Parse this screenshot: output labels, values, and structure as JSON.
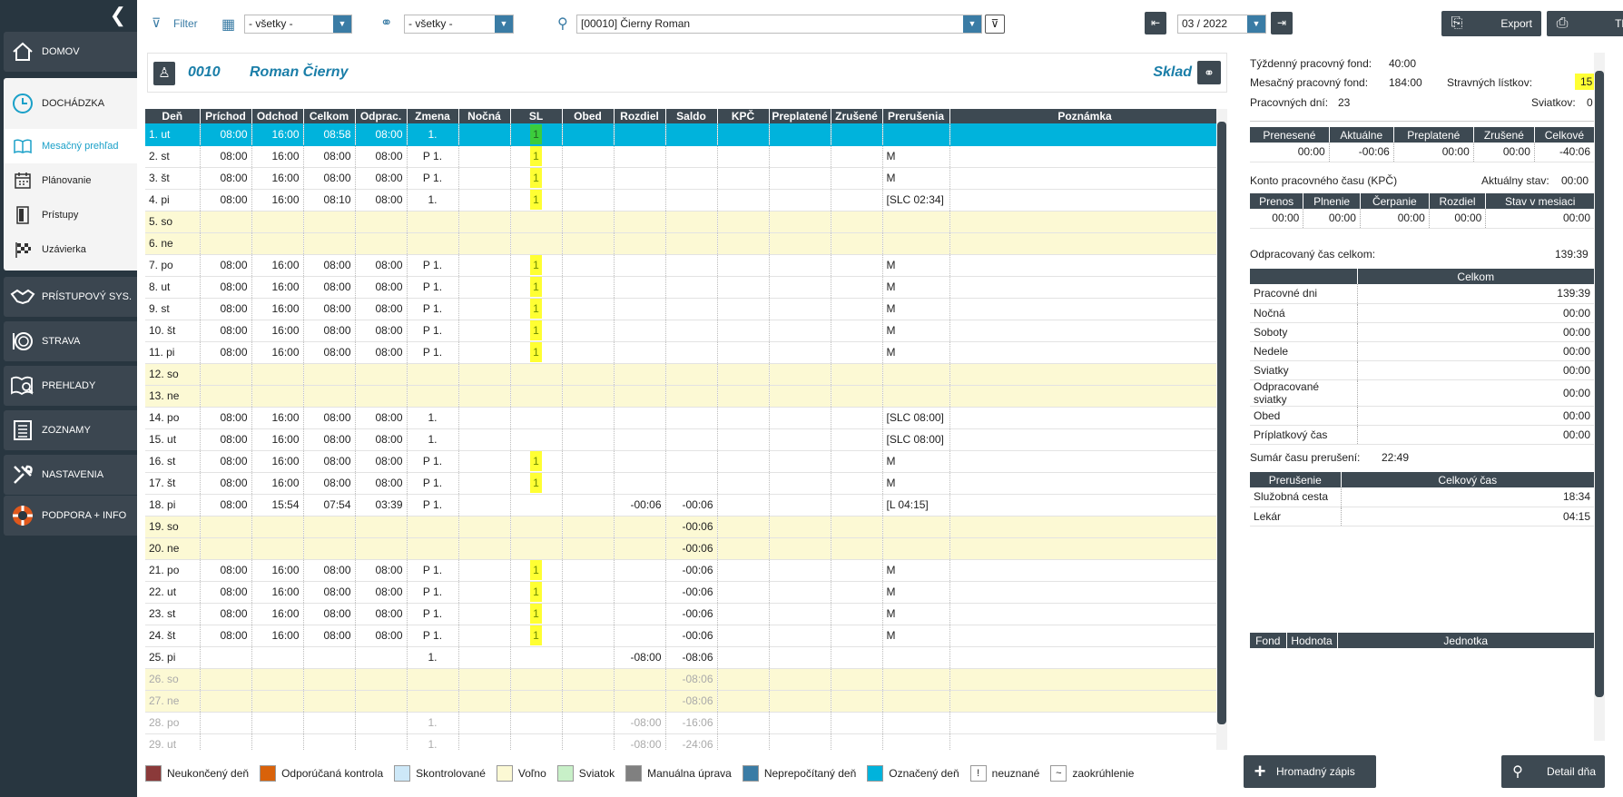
{
  "sidebar": {
    "domov": "DOMOV",
    "dochadzka": "DOCHÁDZKA",
    "sub": [
      "Mesačný prehľad",
      "Plánovanie",
      "Prístupy",
      "Uzávierka"
    ],
    "items": [
      "PRÍSTUPOVÝ SYS.",
      "STRAVA",
      "PREHĽADY",
      "ZOZNAMY",
      "NASTAVENIA",
      "PODPORA + INFO"
    ]
  },
  "toolbar": {
    "filter": "Filter",
    "sel1": "- všetky -",
    "sel2": "- všetky -",
    "person": "[00010] Čierny Roman",
    "period": "03 / 2022",
    "export": "Export",
    "print": "Tlačiť"
  },
  "header": {
    "id": "0010",
    "name": "Roman Čierny",
    "dept": "Sklad"
  },
  "grid": {
    "columns": [
      "Deň",
      "Príchod",
      "Odchod",
      "Celkom",
      "Odprac.",
      "Zmena",
      "Nočná",
      "SL",
      "Obed",
      "Rozdiel",
      "Saldo",
      "KPČ",
      "Preplatené",
      "Zrušené",
      "Prerušenia",
      "Poznámka"
    ],
    "rows": [
      [
        "1. ut",
        "08:00",
        "16:00",
        "08:58",
        "08:00",
        "1.",
        "",
        "1",
        "",
        "",
        "",
        "",
        "",
        "",
        "",
        ""
      ],
      [
        "2. st",
        "08:00",
        "16:00",
        "08:00",
        "08:00",
        "P 1.",
        "",
        "1",
        "",
        "",
        "",
        "",
        "",
        "",
        "M",
        ""
      ],
      [
        "3. št",
        "08:00",
        "16:00",
        "08:00",
        "08:00",
        "P 1.",
        "",
        "1",
        "",
        "",
        "",
        "",
        "",
        "",
        "M",
        ""
      ],
      [
        "4. pi",
        "08:00",
        "16:00",
        "08:10",
        "08:00",
        "1.",
        "",
        "1",
        "",
        "",
        "",
        "",
        "",
        "",
        "[SLC 02:34]",
        ""
      ],
      [
        "5. so",
        "",
        "",
        "",
        "",
        "",
        "",
        "",
        "",
        "",
        "",
        "",
        "",
        "",
        "",
        ""
      ],
      [
        "6. ne",
        "",
        "",
        "",
        "",
        "",
        "",
        "",
        "",
        "",
        "",
        "",
        "",
        "",
        "",
        ""
      ],
      [
        "7. po",
        "08:00",
        "16:00",
        "08:00",
        "08:00",
        "P 1.",
        "",
        "1",
        "",
        "",
        "",
        "",
        "",
        "",
        "M",
        ""
      ],
      [
        "8. ut",
        "08:00",
        "16:00",
        "08:00",
        "08:00",
        "P 1.",
        "",
        "1",
        "",
        "",
        "",
        "",
        "",
        "",
        "M",
        ""
      ],
      [
        "9. st",
        "08:00",
        "16:00",
        "08:00",
        "08:00",
        "P 1.",
        "",
        "1",
        "",
        "",
        "",
        "",
        "",
        "",
        "M",
        ""
      ],
      [
        "10. št",
        "08:00",
        "16:00",
        "08:00",
        "08:00",
        "P 1.",
        "",
        "1",
        "",
        "",
        "",
        "",
        "",
        "",
        "M",
        ""
      ],
      [
        "11. pi",
        "08:00",
        "16:00",
        "08:00",
        "08:00",
        "P 1.",
        "",
        "1",
        "",
        "",
        "",
        "",
        "",
        "",
        "M",
        ""
      ],
      [
        "12. so",
        "",
        "",
        "",
        "",
        "",
        "",
        "",
        "",
        "",
        "",
        "",
        "",
        "",
        "",
        ""
      ],
      [
        "13. ne",
        "",
        "",
        "",
        "",
        "",
        "",
        "",
        "",
        "",
        "",
        "",
        "",
        "",
        "",
        ""
      ],
      [
        "14. po",
        "08:00",
        "16:00",
        "08:00",
        "08:00",
        "1.",
        "",
        "",
        "",
        "",
        "",
        "",
        "",
        "",
        "[SLC 08:00]",
        ""
      ],
      [
        "15. ut",
        "08:00",
        "16:00",
        "08:00",
        "08:00",
        "1.",
        "",
        "",
        "",
        "",
        "",
        "",
        "",
        "",
        "[SLC 08:00]",
        ""
      ],
      [
        "16. st",
        "08:00",
        "16:00",
        "08:00",
        "08:00",
        "P 1.",
        "",
        "1",
        "",
        "",
        "",
        "",
        "",
        "",
        "M",
        ""
      ],
      [
        "17. št",
        "08:00",
        "16:00",
        "08:00",
        "08:00",
        "P 1.",
        "",
        "1",
        "",
        "",
        "",
        "",
        "",
        "",
        "M",
        ""
      ],
      [
        "18. pi",
        "08:00",
        "15:54",
        "07:54",
        "03:39",
        "P 1.",
        "",
        "",
        "",
        "-00:06",
        "-00:06",
        "",
        "",
        "",
        "[L 04:15]",
        ""
      ],
      [
        "19. so",
        "",
        "",
        "",
        "",
        "",
        "",
        "",
        "",
        "",
        "-00:06",
        "",
        "",
        "",
        "",
        ""
      ],
      [
        "20. ne",
        "",
        "",
        "",
        "",
        "",
        "",
        "",
        "",
        "",
        "-00:06",
        "",
        "",
        "",
        "",
        ""
      ],
      [
        "21. po",
        "08:00",
        "16:00",
        "08:00",
        "08:00",
        "P 1.",
        "",
        "1",
        "",
        "",
        "-00:06",
        "",
        "",
        "",
        "M",
        ""
      ],
      [
        "22. ut",
        "08:00",
        "16:00",
        "08:00",
        "08:00",
        "P 1.",
        "",
        "1",
        "",
        "",
        "-00:06",
        "",
        "",
        "",
        "M",
        ""
      ],
      [
        "23. st",
        "08:00",
        "16:00",
        "08:00",
        "08:00",
        "P 1.",
        "",
        "1",
        "",
        "",
        "-00:06",
        "",
        "",
        "",
        "M",
        ""
      ],
      [
        "24. št",
        "08:00",
        "16:00",
        "08:00",
        "08:00",
        "P 1.",
        "",
        "1",
        "",
        "",
        "-00:06",
        "",
        "",
        "",
        "M",
        ""
      ],
      [
        "25. pi",
        "",
        "",
        "",
        "",
        "1.",
        "",
        "",
        "",
        "-08:00",
        "-08:06",
        "",
        "",
        "",
        "",
        ""
      ],
      [
        "26. so",
        "",
        "",
        "",
        "",
        "",
        "",
        "",
        "",
        "",
        "-08:06",
        "",
        "",
        "",
        "",
        ""
      ],
      [
        "27. ne",
        "",
        "",
        "",
        "",
        "",
        "",
        "",
        "",
        "",
        "-08:06",
        "",
        "",
        "",
        "",
        ""
      ],
      [
        "28. po",
        "",
        "",
        "",
        "",
        "1.",
        "",
        "",
        "",
        "-08:00",
        "-16:06",
        "",
        "",
        "",
        "",
        ""
      ],
      [
        "29. ut",
        "",
        "",
        "",
        "",
        "1.",
        "",
        "",
        "",
        "-08:00",
        "-24:06",
        "",
        "",
        "",
        "",
        ""
      ]
    ],
    "row_types": [
      "selected",
      "work",
      "work",
      "work",
      "weekend",
      "weekend",
      "work",
      "work",
      "work",
      "work",
      "work",
      "weekend",
      "weekend",
      "work",
      "work",
      "work",
      "work",
      "work",
      "weekend",
      "weekend",
      "work",
      "work",
      "work",
      "work",
      "work",
      "weekend",
      "weekend",
      "future",
      "future"
    ],
    "future_weekend_rows": [
      25,
      26
    ]
  },
  "legend": [
    {
      "label": "Neukončený deň",
      "color": "#8b3a3a"
    },
    {
      "label": "Odporúčaná kontrola",
      "color": "#d9620a"
    },
    {
      "label": "Skontrolované",
      "color": "#cde8f8"
    },
    {
      "label": "Voľno",
      "color": "#fcf9d4"
    },
    {
      "label": "Sviatok",
      "color": "#c8f0c8"
    },
    {
      "label": "Manuálna úprava",
      "color": "#808080"
    },
    {
      "label": "Neprepočítaný deň",
      "color": "#3a7ca5"
    },
    {
      "label": "Označený deň",
      "color": "#00b3dc"
    },
    {
      "label": "neuznané",
      "symbol": "!"
    },
    {
      "label": "zaokrúhlenie",
      "symbol": "~"
    }
  ],
  "summary": {
    "tyzdenny_label": "Týždenný pracovný fond:",
    "tyzdenny": "40:00",
    "mesacny_label": "Mesačný pracovný fond:",
    "mesacny": "184:00",
    "stravne_label": "Stravných lístkov:",
    "stravne": "15",
    "prac_dni_label": "Pracovných dní:",
    "prac_dni": "23",
    "sviatkov_label": "Sviatkov:",
    "sviatkov": "0",
    "balance_headers": [
      "Prenesené",
      "Aktuálne",
      "Preplatené",
      "Zrušené",
      "Celkové"
    ],
    "balance_values": [
      "00:00",
      "-00:06",
      "00:00",
      "00:00",
      "-40:06"
    ],
    "kpc_title": "Konto pracovného času (KPČ)",
    "kpc_state_label": "Aktuálny stav:",
    "kpc_state": "00:00",
    "kpc_headers": [
      "Prenos",
      "Plnenie",
      "Čerpanie",
      "Rozdiel",
      "Stav v mesiaci"
    ],
    "kpc_values": [
      "00:00",
      "00:00",
      "00:00",
      "00:00",
      "00:00"
    ],
    "odprac_label": "Odpracovaný čas celkom:",
    "odprac": "139:39",
    "celkom_header": "Celkom",
    "celkom_rows": [
      [
        "Pracovné dni",
        "139:39"
      ],
      [
        "Nočná",
        "00:00"
      ],
      [
        "Soboty",
        "00:00"
      ],
      [
        "Nedele",
        "00:00"
      ],
      [
        "Sviatky",
        "00:00"
      ],
      [
        "Odpracované sviatky",
        "00:00"
      ],
      [
        "Obed",
        "00:00"
      ],
      [
        "Príplatkový čas",
        "00:00"
      ]
    ],
    "prerus_label": "Sumár času prerušení:",
    "prerus": "22:49",
    "prerus_headers": [
      "Prerušenie",
      "Celkový čas"
    ],
    "prerus_rows": [
      [
        "Služobná cesta",
        "18:34"
      ],
      [
        "Lekár",
        "04:15"
      ]
    ],
    "fond_headers": [
      "Fond",
      "Hodnota",
      "Jednotka"
    ]
  },
  "buttons": {
    "hromadny": "Hromadný zápis",
    "detail": "Detail dňa"
  }
}
